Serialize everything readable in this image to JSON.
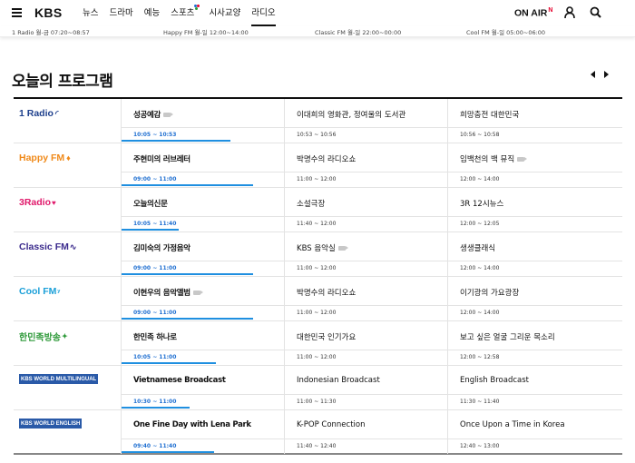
{
  "header": {
    "logo": "KBS",
    "nav": [
      {
        "label": "뉴스"
      },
      {
        "label": "드라마"
      },
      {
        "label": "예능"
      },
      {
        "label": "스포츠"
      },
      {
        "label": "시사교양"
      },
      {
        "label": "라디오"
      }
    ],
    "active_nav": "라디오",
    "on_air": "ON AIR",
    "on_air_mark": "N"
  },
  "ticker": [
    "1 Radio 월-금 07:20~08:57",
    "Happy FM 월-일 12:00~14:00",
    "Classic FM 월-일 22:00~00:00",
    "Cool FM 월-일 05:00~06:00"
  ],
  "section": {
    "title": "오늘의 프로그램"
  },
  "colors": {
    "accent": "#1f8fe0",
    "kbs_red": "#e5002b",
    "happy": "#f08a1a",
    "radio3": "#e0196b",
    "classic": "#3a2a8c",
    "cool": "#1a9fd8",
    "hanminjok": "#2f9a3a",
    "world": "#2a5aa8"
  },
  "schedule": [
    {
      "channel": "1 Radio",
      "channel_icon": "1radio-logo",
      "programs": [
        {
          "title": "성공예감",
          "time": "10:05 ~ 10:53",
          "camera": true,
          "progress": 0.67
        },
        {
          "title": "이대희의 영화관, 정여울의 도서관",
          "time": "10:53 ~ 10:56"
        },
        {
          "title": "희망충전 대한민국",
          "time": "10:56 ~ 10:58"
        }
      ]
    },
    {
      "channel": "Happy FM",
      "channel_icon": "happyfm-logo",
      "programs": [
        {
          "title": "주현미의 러브레터",
          "time": "09:00 ~ 11:00",
          "progress": 0.81
        },
        {
          "title": "박명수의 라디오쇼",
          "time": "11:00 ~ 12:00"
        },
        {
          "title": "임백천의 백 뮤직",
          "time": "12:00 ~ 14:00",
          "camera": true
        }
      ]
    },
    {
      "channel": "3Radio",
      "channel_icon": "3radio-logo",
      "programs": [
        {
          "title": "오늘의신문",
          "time": "10:05 ~ 11:40",
          "progress": 0.35
        },
        {
          "title": "소설극장",
          "time": "11:40 ~ 12:00"
        },
        {
          "title": "3R 12시뉴스",
          "time": "12:00 ~ 12:05"
        }
      ]
    },
    {
      "channel": "Classic FM",
      "channel_icon": "classicfm-logo",
      "programs": [
        {
          "title": "김미숙의 가정음악",
          "time": "09:00 ~ 11:00",
          "progress": 0.81
        },
        {
          "title": "KBS 음악실",
          "time": "11:00 ~ 12:00",
          "camera": true
        },
        {
          "title": "생생클래식",
          "time": "12:00 ~ 14:00"
        }
      ]
    },
    {
      "channel": "Cool FM",
      "channel_icon": "coolfm-logo",
      "programs": [
        {
          "title": "이현우의 음악앨범",
          "time": "09:00 ~ 11:00",
          "camera": true,
          "progress": 0.81
        },
        {
          "title": "박명수의 라디오쇼",
          "time": "11:00 ~ 12:00"
        },
        {
          "title": "이기광의 가요광장",
          "time": "12:00 ~ 14:00"
        }
      ]
    },
    {
      "channel": "한민족방송",
      "channel_icon": "hanminjok-logo",
      "programs": [
        {
          "title": "한민족 하나로",
          "time": "10:05 ~ 11:00",
          "progress": 0.58
        },
        {
          "title": "대한민국 인기가요",
          "time": "11:00 ~ 12:00"
        },
        {
          "title": "보고 싶은 얼굴 그리운 목소리",
          "time": "12:00 ~ 12:58"
        }
      ]
    },
    {
      "channel": "KBS WORLD MULTILINGUAL",
      "channel_icon": "kbsworld-multilingual-logo",
      "programs": [
        {
          "title": "Vietnamese Broadcast",
          "time": "10:30 ~ 11:00",
          "progress": 0.42
        },
        {
          "title": "Indonesian Broadcast",
          "time": "11:00 ~ 11:30"
        },
        {
          "title": "English Broadcast",
          "time": "11:30 ~ 11:40"
        }
      ]
    },
    {
      "channel": "KBS WORLD ENGLISH",
      "channel_icon": "kbsworld-english-logo",
      "programs": [
        {
          "title": "One Fine Day with Lena Park",
          "time": "09:40 ~ 11:40",
          "progress": 0.57
        },
        {
          "title": "K-POP Connection",
          "time": "11:40 ~ 12:40"
        },
        {
          "title": "Once Upon a Time in Korea",
          "time": "12:40 ~ 13:00"
        }
      ]
    }
  ]
}
